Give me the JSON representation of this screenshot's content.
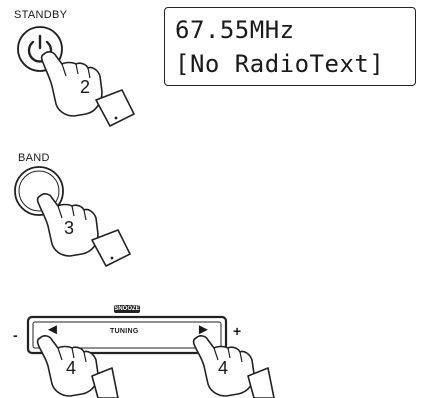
{
  "standby": {
    "label": "STANDBY",
    "step": "2"
  },
  "display": {
    "line1": "67.55MHz",
    "line2": "[No RadioText]"
  },
  "band": {
    "label": "BAND",
    "step": "3"
  },
  "tuning": {
    "snooze_label": "SNOOZE",
    "label": "TUNING",
    "left_arrow": "◄",
    "right_arrow": "►",
    "minus": "-",
    "plus": "+",
    "step_left": "4",
    "step_right": "4"
  }
}
